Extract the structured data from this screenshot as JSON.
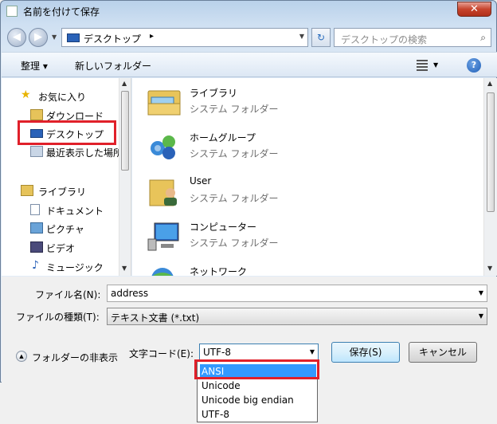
{
  "window": {
    "title": "名前を付けて保存",
    "close_label": "✕"
  },
  "nav": {
    "back_label": "◀",
    "forward_label": "▶",
    "address": "デスクトップ",
    "address_chevron": "▸",
    "search_placeholder": "デスクトップの検索"
  },
  "toolbar": {
    "organize": "整理 ▾",
    "new_folder": "新しいフォルダー",
    "help": "?"
  },
  "sidebar": {
    "items": [
      {
        "label": "お気に入り"
      },
      {
        "label": "ダウンロード"
      },
      {
        "label": "デスクトップ"
      },
      {
        "label": "最近表示した場所"
      },
      {
        "label": "ライブラリ"
      },
      {
        "label": "ドキュメント"
      },
      {
        "label": "ピクチャ"
      },
      {
        "label": "ビデオ"
      },
      {
        "label": "ミュージック"
      }
    ]
  },
  "files": [
    {
      "name": "ライブラリ",
      "type": "システム フォルダー",
      "icon": "library-icon"
    },
    {
      "name": "ホームグループ",
      "type": "システム フォルダー",
      "icon": "homegroup-icon"
    },
    {
      "name": "User",
      "type": "システム フォルダー",
      "icon": "user-folder-icon"
    },
    {
      "name": "コンピューター",
      "type": "システム フォルダー",
      "icon": "computer-icon"
    },
    {
      "name": "ネットワーク",
      "type": "",
      "icon": "network-icon"
    }
  ],
  "form": {
    "filename_label": "ファイル名(N):",
    "filename_value": "address",
    "filetype_label": "ファイルの種類(T):",
    "filetype_value": "テキスト文書 (*.txt)",
    "encoding_label": "文字コード(E):",
    "encoding_value": "UTF-8",
    "save_label": "保存(S)",
    "cancel_label": "キャンセル",
    "hide_folders_label": "フォルダーの非表示"
  },
  "encoding_options": [
    "ANSI",
    "Unicode",
    "Unicode big endian",
    "UTF-8"
  ],
  "colors": {
    "highlight_red": "#e0202a",
    "selection_blue": "#3399ff"
  }
}
